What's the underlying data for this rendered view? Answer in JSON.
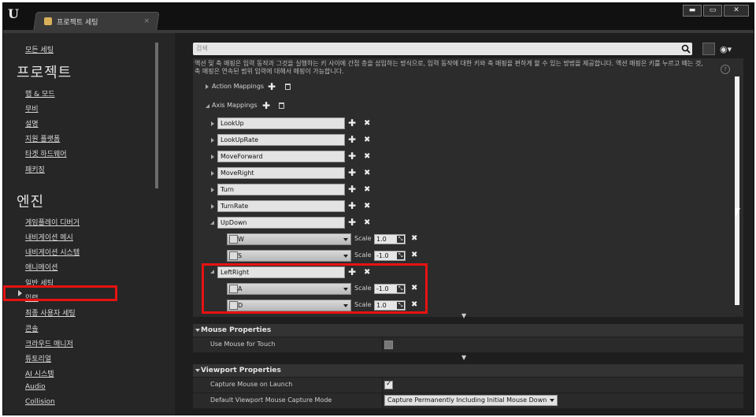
{
  "window": {
    "tab_title": "프로젝트 세팅",
    "tab_close": "×",
    "btn_minimize": "▬",
    "btn_maximize": "▭",
    "btn_close": "✕",
    "logo": "U"
  },
  "sidebar": {
    "all_settings": "모든 세팅",
    "section_project": "프로젝트",
    "project_items": [
      "맵 & 모드",
      "무비",
      "설명",
      "지원 플랫폼",
      "타겟 하드웨어",
      "패키징"
    ],
    "section_engine": "엔진",
    "engine_items": [
      "게임플레이 디버거",
      "내비게이션 메시",
      "내비게이션 시스템",
      "애니메이션",
      "일반 세팅",
      "입력",
      "최종 사용자 세팅",
      "콘솔",
      "크라우드 매니저",
      "튜토리얼",
      "AI 시스템",
      "Audio",
      "Collision"
    ],
    "selected_item": "입력"
  },
  "main": {
    "search_placeholder": "검색",
    "description": "액션 및 축 매핑은 입력 동작과 그것을 실행하는 키 사이에 간접 층을 삽입하는 방식으로, 입력 동작에 대한 키와 축 매핑을 편하게 할 수 있는 방법을 제공합니다. 액션 매핑은 키를 누르고 떼는 것, 축 매핑은 연속된 범위 입력에 대해서 매핑이 가능합니다.",
    "action_mappings_label": "Action Mappings",
    "axis_mappings_label": "Axis Mappings",
    "axis_names": [
      "LookUp",
      "LookUpRate",
      "MoveForward",
      "MoveRight",
      "Turn",
      "TurnRate",
      "UpDown",
      "LeftRight"
    ],
    "updown_keys": [
      {
        "key": "W",
        "scale": "1.0"
      },
      {
        "key": "S",
        "scale": "-1.0"
      }
    ],
    "leftright_keys": [
      {
        "key": "A",
        "scale": "-1.0"
      },
      {
        "key": "D",
        "scale": "1.0"
      }
    ],
    "scale_label": "Scale",
    "mouse_section": "Mouse Properties",
    "use_mouse_for_touch": "Use Mouse for Touch",
    "use_mouse_for_touch_checked": false,
    "viewport_section": "Viewport Properties",
    "capture_mouse_on_launch": "Capture Mouse on Launch",
    "capture_mouse_on_launch_checked": true,
    "default_capture_mode_label": "Default Viewport Mouse Capture Mode",
    "default_capture_mode_value": "Capture Permanently Including Initial Mouse Down"
  },
  "colors": {
    "highlight": "#e81212",
    "background": "#1e1e1e",
    "panel": "#2c2c2c"
  }
}
